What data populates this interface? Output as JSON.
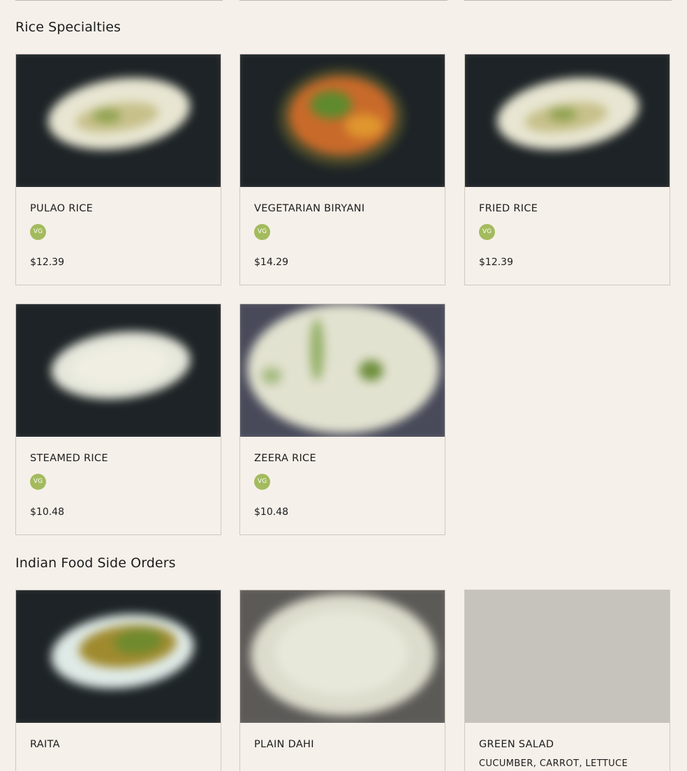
{
  "sections": [
    {
      "title": "Rice Specialties",
      "items": [
        {
          "name": "PULAO RICE",
          "badge": "VG",
          "price": "$12.39"
        },
        {
          "name": "VEGETARIAN BIRYANI",
          "badge": "VG",
          "price": "$14.29"
        },
        {
          "name": "FRIED RICE",
          "badge": "VG",
          "price": "$12.39"
        },
        {
          "name": "STEAMED RICE",
          "badge": "VG",
          "price": "$10.48"
        },
        {
          "name": "ZEERA RICE",
          "badge": "VG",
          "price": "$10.48"
        }
      ]
    },
    {
      "title": "Indian Food Side Orders",
      "items": [
        {
          "name": "RAITA"
        },
        {
          "name": "PLAIN DAHI"
        },
        {
          "name": "GREEN SALAD",
          "description": "CUCUMBER, CARROT, LETTUCE"
        }
      ]
    }
  ],
  "colors": {
    "background": "#f6f0ea",
    "vegan_badge": "#a3bb5e",
    "card_border": "#cfc8c0",
    "image_placeholder": "#c6c2bc"
  },
  "icons": {
    "vegan_badge": "vg-badge-icon"
  }
}
